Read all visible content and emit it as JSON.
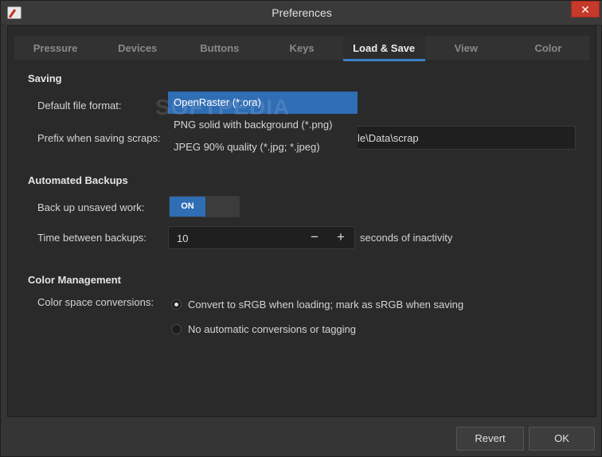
{
  "window": {
    "title": "Preferences",
    "close_glyph": "✕"
  },
  "tabs": [
    {
      "label": "Pressure"
    },
    {
      "label": "Devices"
    },
    {
      "label": "Buttons"
    },
    {
      "label": "Keys"
    },
    {
      "label": "Load & Save",
      "active": true
    },
    {
      "label": "View"
    },
    {
      "label": "Color"
    }
  ],
  "saving": {
    "title": "Saving",
    "default_format_label": "Default file format:",
    "format_options": [
      "OpenRaster (*.ora)",
      "PNG solid with background (*.png)",
      "JPEG 90% quality (*.jpg; *.jpeg)"
    ],
    "selected_format_index": 0,
    "prefix_label": "Prefix when saving scraps:",
    "prefix_value_visible": "le\\Data\\scrap"
  },
  "backups": {
    "title": "Automated Backups",
    "unsaved_label": "Back up unsaved work:",
    "toggle_on_label": "ON",
    "interval_label": "Time between backups:",
    "interval_value": "10",
    "minus_glyph": "−",
    "plus_glyph": "+",
    "interval_suffix": "seconds of inactivity"
  },
  "color_mgmt": {
    "title": "Color Management",
    "conversions_label": "Color space conversions:",
    "options": [
      {
        "label": "Convert to sRGB when loading; mark as sRGB when saving",
        "checked": true
      },
      {
        "label": "No automatic conversions or tagging",
        "checked": false
      }
    ]
  },
  "watermark": "SOFTPEDIA",
  "footer": {
    "revert_label": "Revert",
    "ok_label": "OK"
  }
}
